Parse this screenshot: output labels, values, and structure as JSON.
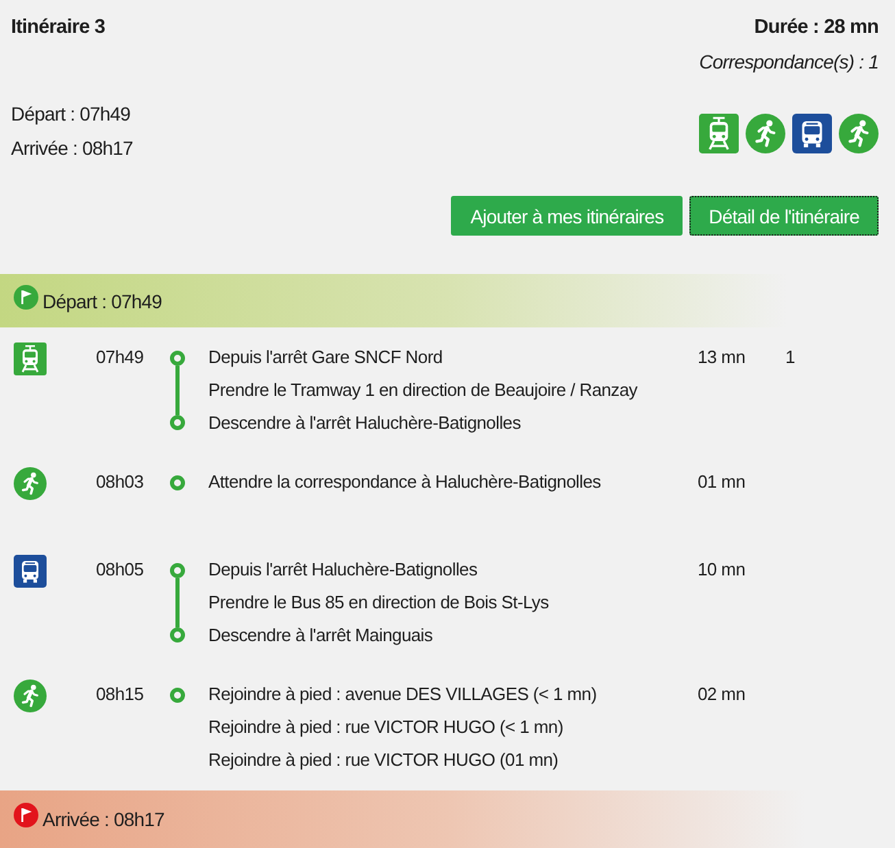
{
  "header": {
    "title": "Itinéraire 3",
    "duration": "Durée : 28 mn",
    "transfers": "Correspondance(s) : 1",
    "departure": "Départ : 07h49",
    "arrival": "Arrivée : 08h17",
    "modes": [
      {
        "kind": "tram"
      },
      {
        "kind": "walk"
      },
      {
        "kind": "bus"
      },
      {
        "kind": "walk"
      }
    ]
  },
  "buttons": [
    {
      "label": "Ajouter à mes itinéraires",
      "focused": false
    },
    {
      "label": "Détail de l'itinéraire",
      "focused": true
    }
  ],
  "start": {
    "label": "Départ : 07h49"
  },
  "steps": [
    {
      "kind": "tram",
      "time": "07h49",
      "lines": [
        "Depuis l'arrêt Gare SNCF Nord",
        "Prendre le Tramway 1 en direction de Beaujoire / Ranzay",
        "Descendre à l'arrêt Haluchère-Batignolles"
      ],
      "duration": "13 mn",
      "column_5": "1"
    },
    {
      "kind": "walk",
      "time": "08h03",
      "lines": [
        "Attendre la correspondance à Haluchère-Batignolles"
      ],
      "duration": "01 mn"
    },
    {
      "kind": "bus",
      "time": "08h05",
      "lines": [
        "Depuis l'arrêt Haluchère-Batignolles",
        "Prendre le Bus 85 en direction de Bois St-Lys",
        "Descendre à l'arrêt Mainguais"
      ],
      "duration": "10 mn"
    },
    {
      "kind": "walk",
      "time": "08h15",
      "lines": [
        "Rejoindre à pied : avenue DES VILLAGES (< 1 mn)",
        "Rejoindre à pied : rue VICTOR HUGO (< 1 mn)",
        "Rejoindre à pied : rue VICTOR HUGO (01 mn)"
      ],
      "duration": "02 mn"
    }
  ],
  "end": {
    "label": "Arrivée : 08h17"
  }
}
